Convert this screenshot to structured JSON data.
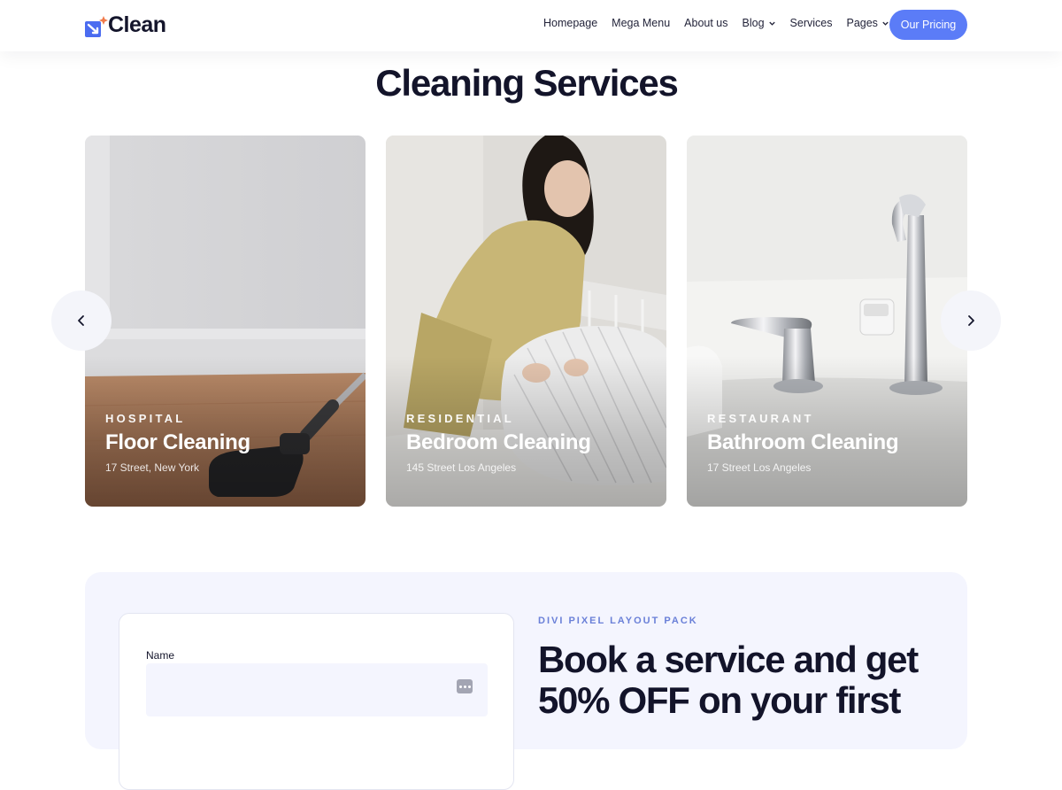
{
  "header": {
    "brand": "Clean",
    "nav": [
      {
        "label": "Homepage",
        "dropdown": false
      },
      {
        "label": "Mega Menu",
        "dropdown": false
      },
      {
        "label": "About us",
        "dropdown": false
      },
      {
        "label": "Blog",
        "dropdown": true
      },
      {
        "label": "Services",
        "dropdown": false
      },
      {
        "label": "Pages",
        "dropdown": true
      }
    ],
    "cta": "Our Pricing"
  },
  "services": {
    "title": "Cleaning Services",
    "cards": [
      {
        "category": "HOSPITAL",
        "title": "Floor Cleaning",
        "address": "17 Street, New York"
      },
      {
        "category": "RESIDENTIAL",
        "title": "Bedroom Cleaning",
        "address": "145 Street Los Angeles"
      },
      {
        "category": "RESTAURANT",
        "title": "Bathroom Cleaning",
        "address": "17 Street Los Angeles"
      }
    ],
    "prev_icon": "chevron-left-icon",
    "next_icon": "chevron-right-icon"
  },
  "booking": {
    "form": {
      "name_label": "Name",
      "name_value": "",
      "field_icon": "more-dots-icon"
    },
    "eyebrow": "DIVI PIXEL LAYOUT PACK",
    "heading": "Book a service and get 50% OFF on your first"
  },
  "colors": {
    "accent": "#5b7cf7",
    "eyebrow": "#6a80d8",
    "text": "#13142a",
    "booking_bg": "#f4f5fe"
  }
}
